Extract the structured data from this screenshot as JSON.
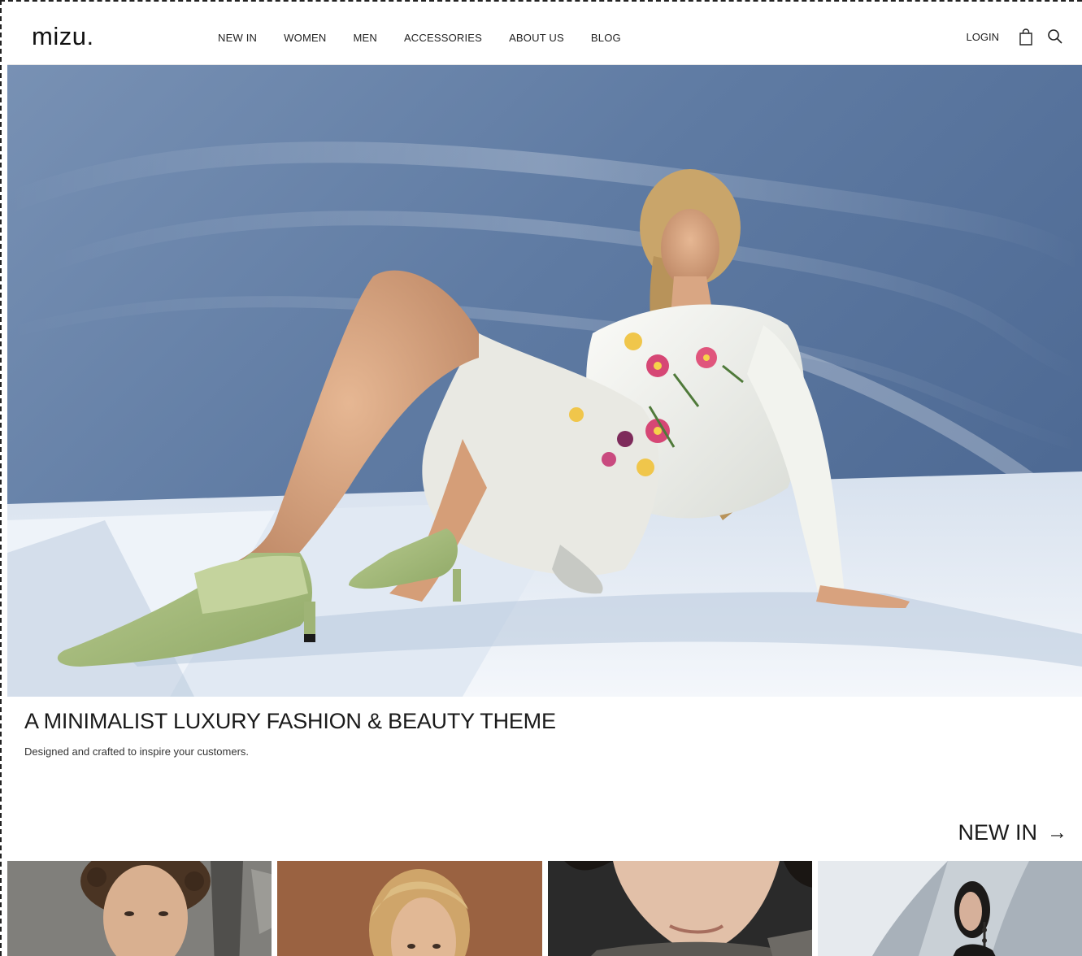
{
  "brand": {
    "logo_text": "mizu."
  },
  "nav": {
    "items": [
      {
        "label": "NEW IN"
      },
      {
        "label": "WOMEN"
      },
      {
        "label": "MEN"
      },
      {
        "label": "ACCESSORIES"
      },
      {
        "label": "ABOUT US"
      },
      {
        "label": "BLOG"
      }
    ],
    "login_label": "LOGIN",
    "cart_icon": "shopping-bag-icon",
    "search_icon": "search-icon"
  },
  "hero": {
    "image": "woman-in-white-floral-suit-green-heels",
    "title": "A MINIMALIST LUXURY FASHION & BEAUTY THEME",
    "subtitle": "Designed and crafted to inspire your customers."
  },
  "new_in": {
    "link_label": "NEW IN",
    "arrow_icon": "arrow-right-icon",
    "products": [
      {
        "image": "curly-haired-man-portrait"
      },
      {
        "image": "blonde-woman-portrait"
      },
      {
        "image": "man-face-close-up"
      },
      {
        "image": "woman-with-earrings-portrait"
      }
    ]
  },
  "colors": {
    "text": "#1a1a1a",
    "hero_background": "#5d7aa3",
    "floor": "#e8eef6",
    "accent_green": "#a9bf7f"
  }
}
